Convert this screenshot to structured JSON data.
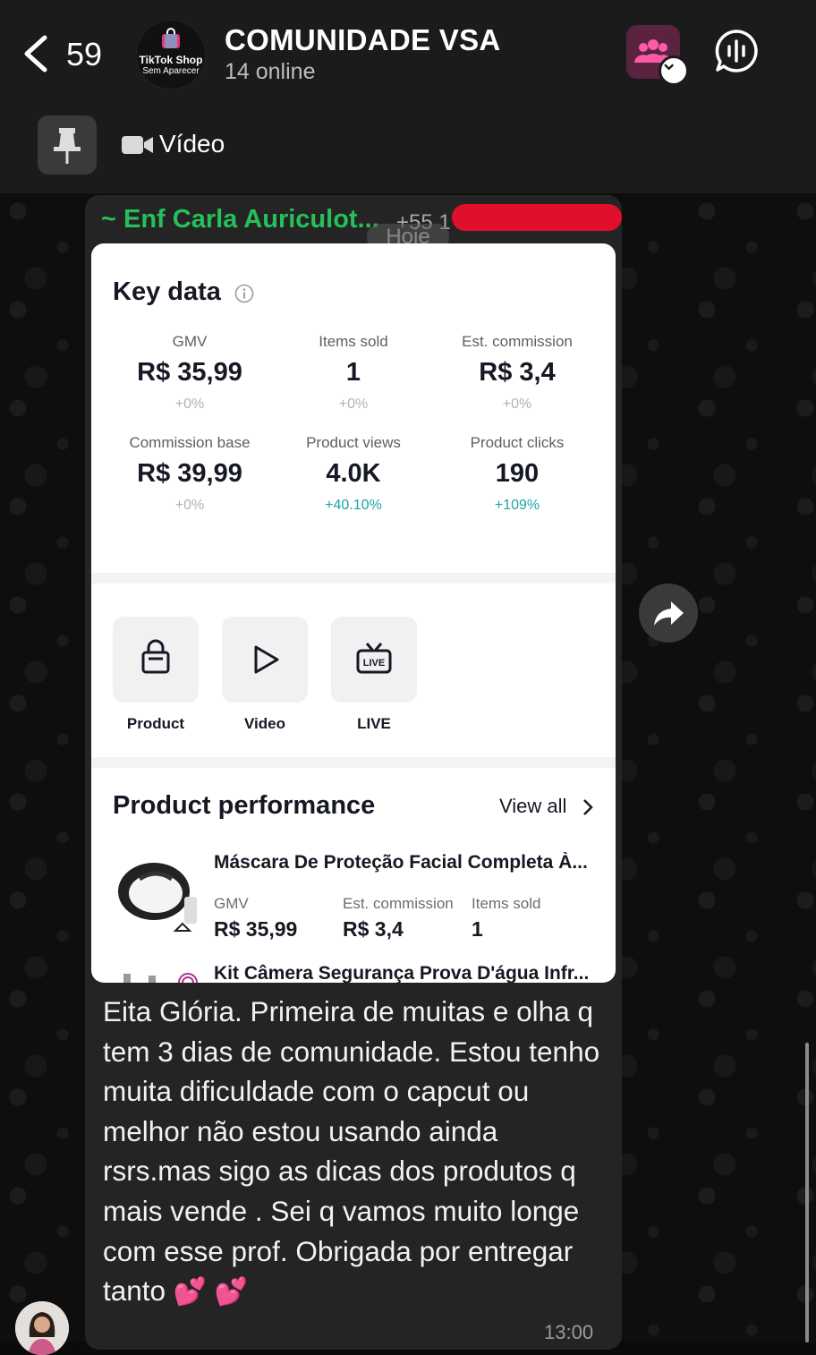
{
  "header": {
    "back_count": "59",
    "avatar_line1": "TikTok Shop",
    "avatar_line2": "Sem Aparecer",
    "title": "COMUNIDADE VSA",
    "subtitle": "14 online"
  },
  "pinned": {
    "label": "Vídeo"
  },
  "message": {
    "sender_name": "~ Enf Carla Auriculot...",
    "sender_phone": "+55 1",
    "date_chip": "Hoje",
    "text": "Eita Glória. Primeira de muitas e olha q tem 3 dias de comunidade. Estou tenho muita dificuldade com o capcut ou melhor não estou usando ainda rsrs.mas sigo as dicas dos produtos q mais vende . Sei q vamos muito longe com esse prof. Obrigada por entregar tanto",
    "emoji": "💕 💕",
    "time": "13:00"
  },
  "screenshot": {
    "key_data_title": "Key data",
    "metrics": [
      {
        "label": "GMV",
        "value": "R$ 35,99",
        "change": "+0%"
      },
      {
        "label": "Items sold",
        "value": "1",
        "change": "+0%"
      },
      {
        "label": "Est. commission",
        "value": "R$ 3,4",
        "change": "+0%"
      },
      {
        "label": "Commission base",
        "value": "R$ 39,99",
        "change": "+0%"
      },
      {
        "label": "Product views",
        "value": "4.0K",
        "change": "+40.10%"
      },
      {
        "label": "Product clicks",
        "value": "190",
        "change": "+109%"
      }
    ],
    "quick_actions": [
      {
        "label": "Product",
        "icon": "shopping-bag-icon"
      },
      {
        "label": "Video",
        "icon": "play-icon"
      },
      {
        "label": "LIVE",
        "icon": "live-tv-icon"
      }
    ],
    "product_performance_title": "Product performance",
    "view_all": "View all",
    "products": [
      {
        "name": "Máscara De Proteção Facial Completa À...",
        "gmv_label": "GMV",
        "gmv": "R$ 35,99",
        "commission_label": "Est. commission",
        "commission": "R$ 3,4",
        "items_label": "Items sold",
        "items": "1"
      },
      {
        "name": "Kit Câmera Segurança Prova D'água Infr..."
      }
    ]
  },
  "colors": {
    "sender": "#25c05a",
    "members_button": "#5a2340",
    "positive_change": "#1aa5a5"
  }
}
